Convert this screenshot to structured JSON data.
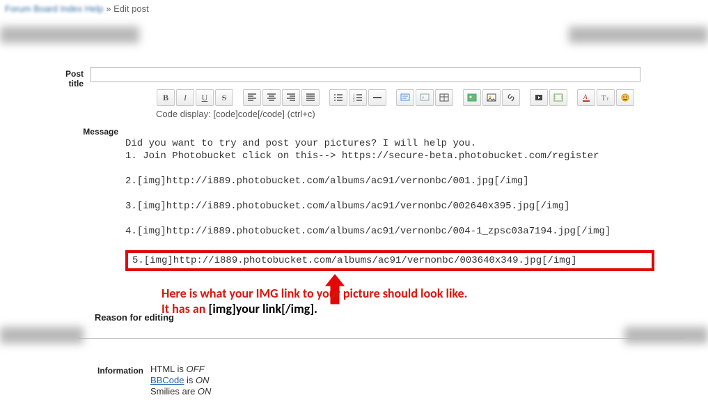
{
  "breadcrumb": {
    "blurred": "Forum Board Index Help",
    "sep": " » ",
    "current": "Edit post"
  },
  "labels": {
    "post_title": "Post title",
    "message": "Message",
    "reason": "Reason for editing",
    "info": "Information"
  },
  "title_value": "",
  "toolbar": {
    "b": "B",
    "i": "I",
    "u": "U",
    "s": "S"
  },
  "code_hint": "Code display: [code]code[/code] (ctrl+c)",
  "message_lines": {
    "intro1": "Did you want to try and post your pictures? I will help you.",
    "intro2": "1. Join Photobucket click on this--> https://secure-beta.photobucket.com/register",
    "l2": "2.[img]http://i889.photobucket.com/albums/ac91/vernonbc/001.jpg[/img]",
    "l3": "3.[img]http://i889.photobucket.com/albums/ac91/vernonbc/002640x395.jpg[/img]",
    "l4": "4.[img]http://i889.photobucket.com/albums/ac91/vernonbc/004-1_zpsc03a7194.jpg[/img]",
    "l5": "5.[img]http://i889.photobucket.com/albums/ac91/vernonbc/003640x349.jpg[/img]"
  },
  "annotation": {
    "line1": "Here is what your IMG link to your picture should look like.",
    "line2a": "It has an ",
    "line2b": "[img]your link[/img]",
    "line2c": "."
  },
  "info": {
    "html": "HTML is ",
    "off": "OFF",
    "bbcode": "BBCode",
    "is": " is ",
    "on": "ON",
    "smilies": "Smilies are ",
    "on2": "ON"
  }
}
